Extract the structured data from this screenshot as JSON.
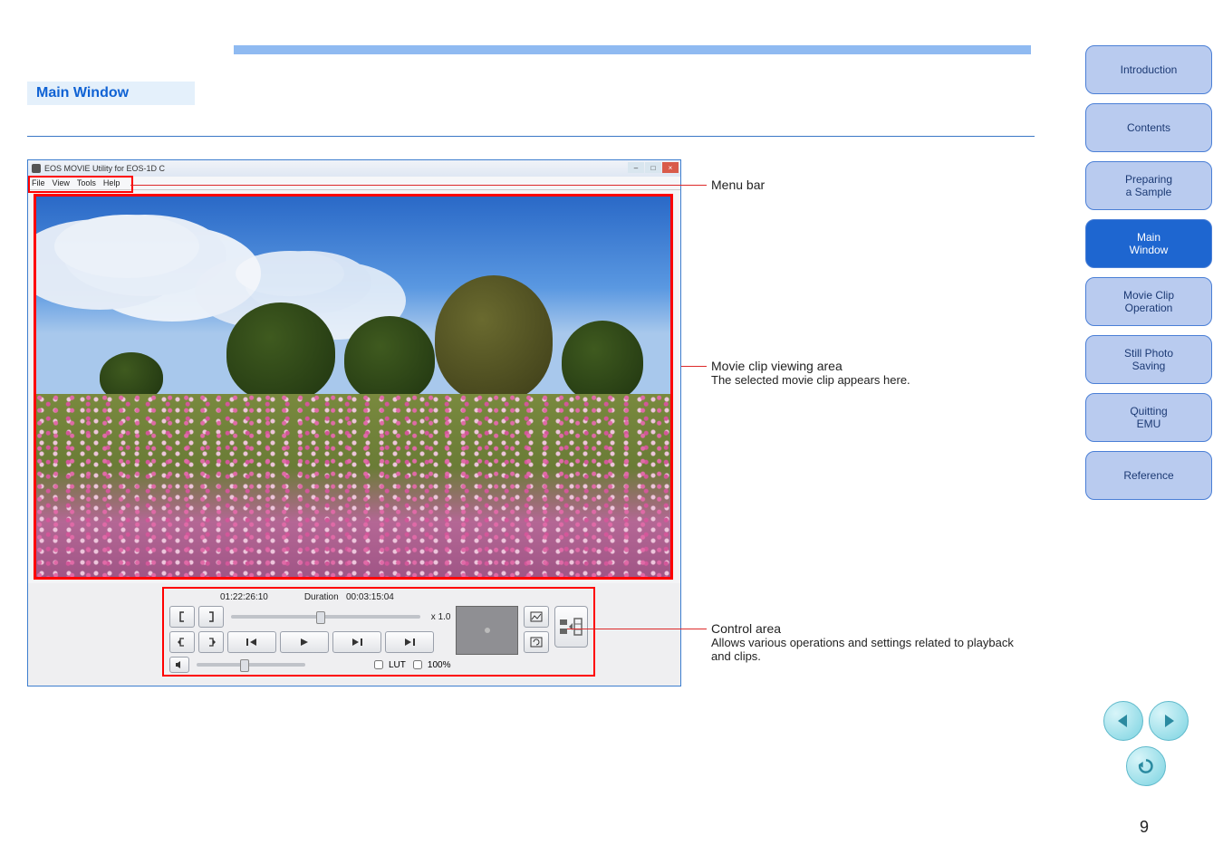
{
  "page": {
    "label_main_window": "Main Window",
    "page_number": "9"
  },
  "sidebar": {
    "items": [
      {
        "label": "Introduction"
      },
      {
        "label": "Contents"
      },
      {
        "label_line1": "Preparing",
        "label_line2": "a Sample"
      },
      {
        "label_line1": "Main",
        "label_line2": "Window"
      },
      {
        "label_line1": "Movie Clip",
        "label_line2": "Operation"
      },
      {
        "label_line1": "Still Photo",
        "label_line2": "Saving"
      },
      {
        "label_line1": "Quitting",
        "label_line2": "EMU"
      },
      {
        "label": "Reference"
      }
    ]
  },
  "app": {
    "title": "EOS MOVIE Utility for EOS-1D C",
    "menus": [
      "File",
      "View",
      "Tools",
      "Help"
    ],
    "timecode": "01:22:26:10",
    "duration_label": "Duration",
    "duration": "00:03:15:04",
    "speed": "x 1.0",
    "lut_label": "LUT",
    "hundred_label": "100%"
  },
  "callouts": {
    "menu_title": "Menu bar",
    "view_title": "Movie clip viewing area",
    "view_desc": "The selected movie clip appears here.",
    "ctrl_title": "Control area",
    "ctrl_desc": "Allows various operations and settings related to playback and clips."
  },
  "pager": {
    "prev": "prev",
    "next": "next",
    "back": "back"
  }
}
